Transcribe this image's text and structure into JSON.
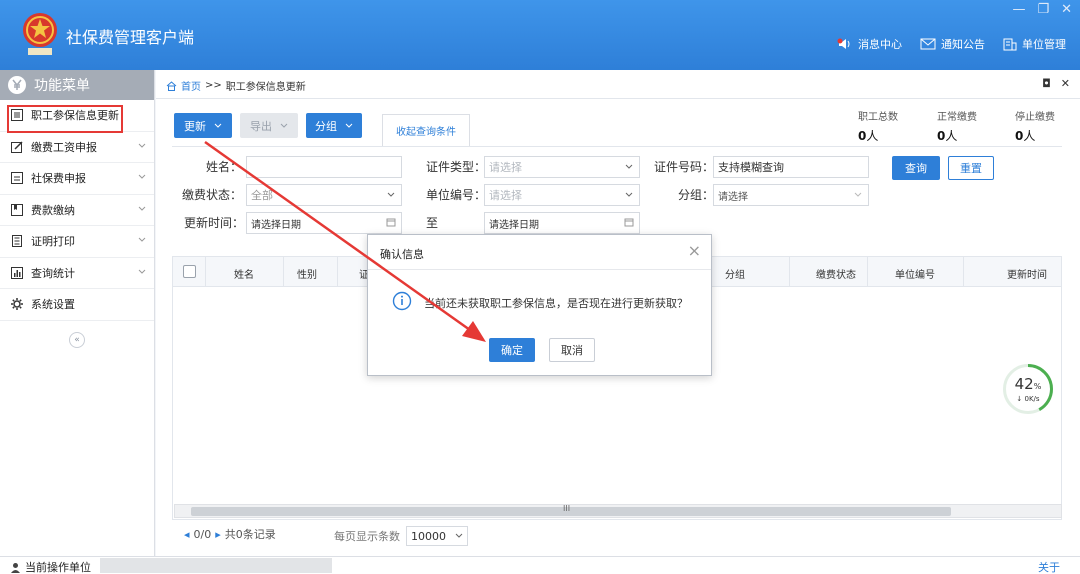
{
  "app": {
    "title": "社保费管理客户端",
    "window_controls": [
      "—",
      "❐",
      "✕"
    ],
    "top_links": [
      {
        "label": "消息中心",
        "icon": "speaker-icon"
      },
      {
        "label": "通知公告",
        "icon": "mail-icon"
      },
      {
        "label": "单位管理",
        "icon": "building-icon"
      }
    ]
  },
  "sidebar": {
    "heading": "功能菜单",
    "items": [
      {
        "label": "职工参保信息更新",
        "icon": "list-icon"
      },
      {
        "label": "缴费工资申报",
        "icon": "edit-icon"
      },
      {
        "label": "社保费申报",
        "icon": "form-icon"
      },
      {
        "label": "费款缴纳",
        "icon": "bookmark-icon"
      },
      {
        "label": "证明打印",
        "icon": "document-icon"
      },
      {
        "label": "查询统计",
        "icon": "chart-icon"
      },
      {
        "label": "系统设置",
        "icon": "gear-icon"
      }
    ],
    "collapse_symbol": "«"
  },
  "main": {
    "breadcrumb": {
      "home": "首页",
      "sep": ">>",
      "current": "职工参保信息更新"
    },
    "tab_controls": [
      "◘",
      "✕"
    ],
    "toolbar": {
      "update_label": "更新",
      "export_label": "导出",
      "group_label": "分组",
      "collapse_tab_label": "收起查询条件"
    },
    "stats": [
      {
        "label": "职工总数",
        "value": "0",
        "unit": "人"
      },
      {
        "label": "正常缴费",
        "value": "0",
        "unit": "人"
      },
      {
        "label": "停止缴费",
        "value": "0",
        "unit": "人"
      }
    ],
    "filters": {
      "name_label": "姓名：",
      "name_value": "",
      "id_type_label": "证件类型：",
      "id_type_placeholder": "请选择",
      "id_number_label": "证件号码：",
      "id_number_value": "支持模糊查询",
      "query_btn": "查询",
      "reset_btn": "重置",
      "pay_status_label": "缴费状态：",
      "pay_status_value": "全部",
      "unit_code_label": "单位编号：",
      "unit_code_placeholder": "请选择",
      "group_label": "分组：",
      "group_placeholder": "请选择",
      "update_time_label": "更新时间：",
      "date_from_placeholder": "请选择日期",
      "to_label": "至",
      "date_to_placeholder": "请选择日期"
    },
    "table": {
      "columns": [
        "姓名",
        "性别",
        "证",
        "分组",
        "缴费状态",
        "单位编号",
        "更新时间"
      ],
      "scroll_thumb_label": "III"
    },
    "pager": {
      "page_info": "0/0",
      "total": "共0条记录",
      "page_size_label": "每页显示条数",
      "page_size_value": "10000"
    },
    "speed_gauge": {
      "percent": "42",
      "percent_unit": "%",
      "speed": "0K/s",
      "progress": 0.42
    }
  },
  "dialog": {
    "title": "确认信息",
    "close": "×",
    "message": "当前还未获取职工参保信息，是否现在进行更新获取？",
    "ok": "确定",
    "cancel": "取消"
  },
  "statusbar": {
    "left_label": "当前操作单位",
    "right_label": "关于"
  },
  "colors": {
    "accent": "#2e7fd8",
    "highlight_box": "#e53935",
    "annotation_arrow": "#e53935"
  }
}
